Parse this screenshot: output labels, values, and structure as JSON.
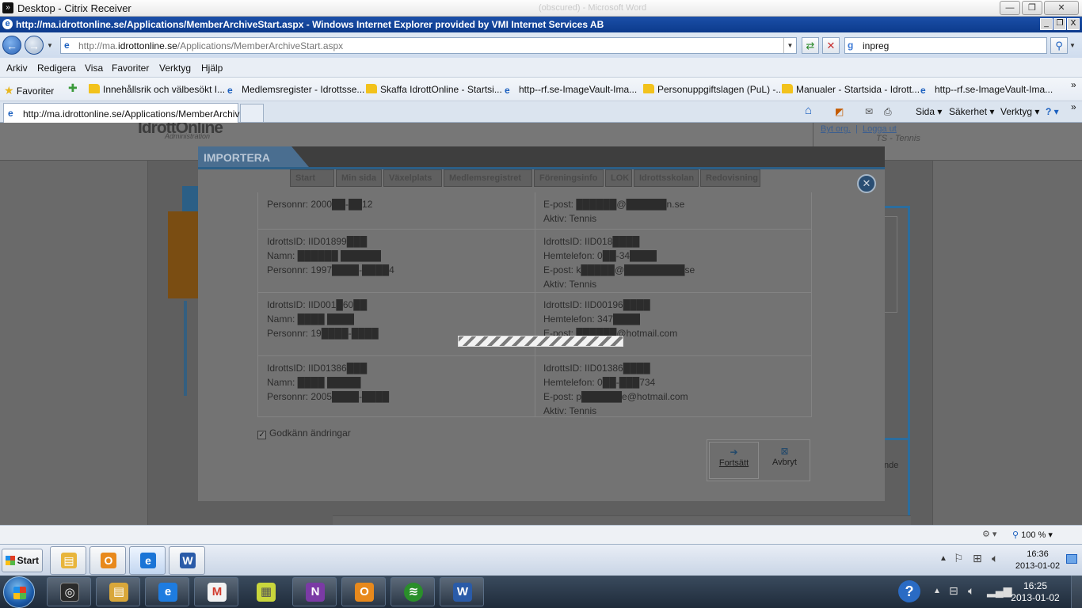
{
  "citrix": {
    "title": "Desktop - Citrix Receiver",
    "ghost_title": "(obscured) - Microsoft Word",
    "controls": [
      "—",
      "❐",
      "✕"
    ]
  },
  "ie": {
    "title": "http://ma.idrottonline.se/Applications/MemberArchiveStart.aspx - Windows Internet Explorer provided by VMI Internet Services AB",
    "controls": [
      "_",
      "❐",
      "X"
    ],
    "address_prefix": "http://ma.",
    "address_domain": "idrottonline.se",
    "address_path": "/Applications/MemberArchiveStart.aspx",
    "search_value": "inpreg",
    "menu": [
      "Arkiv",
      "Redigera",
      "Visa",
      "Favoriter",
      "Verktyg",
      "Hjälp"
    ],
    "favorites_label": "Favoriter",
    "favorites": [
      {
        "label": "Innehållsrik och välbesökt I...",
        "icon": "folder-icon"
      },
      {
        "label": "Medlemsregister - Idrottsse...",
        "icon": "ie-page-icon"
      },
      {
        "label": "Skaffa IdrottOnline - Startsi...",
        "icon": "folder-icon"
      },
      {
        "label": "http--rf.se-ImageVault-Ima...",
        "icon": "ie-page-icon"
      },
      {
        "label": "Personuppgiftslagen (PuL) -...",
        "icon": "folder-icon"
      },
      {
        "label": "Manualer - Startsida - Idrott...",
        "icon": "folder-icon"
      },
      {
        "label": "http--rf.se-ImageVault-Ima...",
        "icon": "ie-page-icon"
      }
    ],
    "tab_label": "http://ma.idrottonline.se/Applications/MemberArchive...",
    "command_bar": {
      "page": "Sida",
      "safety": "Säkerhet",
      "tools": "Verktyg"
    },
    "zoom": "100 %"
  },
  "site": {
    "logo": "IdrottOnline",
    "logo_sub": "Administration",
    "nav": [
      "Start",
      "Min sida",
      "Växelplats",
      "Medlemsregistret",
      "Föreningsinfo",
      "LOK",
      "Idrottsskolan",
      "Redovisning"
    ],
    "top_links": [
      "Byt org.",
      "Logga ut"
    ],
    "org_line": "TS - Tennis",
    "right_text": "nde"
  },
  "modal": {
    "title": "IMPORTERA",
    "records": [
      {
        "left": [
          "Personnr: 2000██-██12"
        ],
        "right": [
          "E-post: ██████@██████n.se",
          "Aktiv: Tennis"
        ]
      },
      {
        "left": [
          "IdrottsID: IID01899███",
          "Namn: ██████ ██████",
          "Personnr: 1997████-████4"
        ],
        "right": [
          "IdrottsID: IID018████",
          "Hemtelefon: 0██-34████",
          "E-post: k█████@█████████se",
          "Aktiv: Tennis"
        ]
      },
      {
        "left": [
          "IdrottsID: IID001█60██",
          "Namn: ████ ████",
          "Personnr: 19████-████"
        ],
        "right": [
          "IdrottsID: IID00196████",
          "Hemtelefon: 347████",
          "E-post: ██████@hotmail.com"
        ]
      },
      {
        "left": [
          "IdrottsID: IID01386███",
          "Namn: ████ █████",
          "Personnr: 2005████-████"
        ],
        "right": [
          "IdrottsID: IID01386████",
          "Hemtelefon: 0██-███734",
          "E-post: p██████e@hotmail.com",
          "Aktiv: Tennis"
        ]
      }
    ],
    "approve_label": "Godkänn ändringar",
    "continue_label": "Fortsätt",
    "cancel_label": "Avbryt",
    "loading": true
  },
  "taskbar_inner": {
    "start_label": "Start",
    "apps": [
      {
        "name": "explorer-app",
        "glyph": "▤",
        "color": "#e8b53c"
      },
      {
        "name": "outlook-app",
        "glyph": "O",
        "color": "#e8891c"
      },
      {
        "name": "ie-app",
        "glyph": "e",
        "color": "#1a74d6"
      },
      {
        "name": "word-app",
        "glyph": "W",
        "color": "#2a5ba8"
      }
    ],
    "time": "16:36",
    "date": "2013-01-02"
  },
  "taskbar_outer": {
    "apps": [
      {
        "name": "citrix-app",
        "glyph": "◎",
        "color": "#2a2a2a"
      },
      {
        "name": "explorer-app",
        "glyph": "▤",
        "color": "#d9a73a"
      },
      {
        "name": "ie-app",
        "glyph": "e",
        "color": "#1e7ce0"
      },
      {
        "name": "gmail-app",
        "glyph": "M",
        "color": "#d23a2c"
      },
      {
        "name": "sticky-notes-app",
        "glyph": "▦",
        "color": "#c9d63c"
      },
      {
        "name": "onenote-app",
        "glyph": "N",
        "color": "#7b3aa5"
      },
      {
        "name": "outlook-app",
        "glyph": "O",
        "color": "#e8891c"
      },
      {
        "name": "spotify-app",
        "glyph": "≋",
        "color": "#2a8f2a"
      },
      {
        "name": "word-app",
        "glyph": "W",
        "color": "#2a5ba8"
      }
    ],
    "time": "16:25",
    "date": "2013-01-02"
  }
}
